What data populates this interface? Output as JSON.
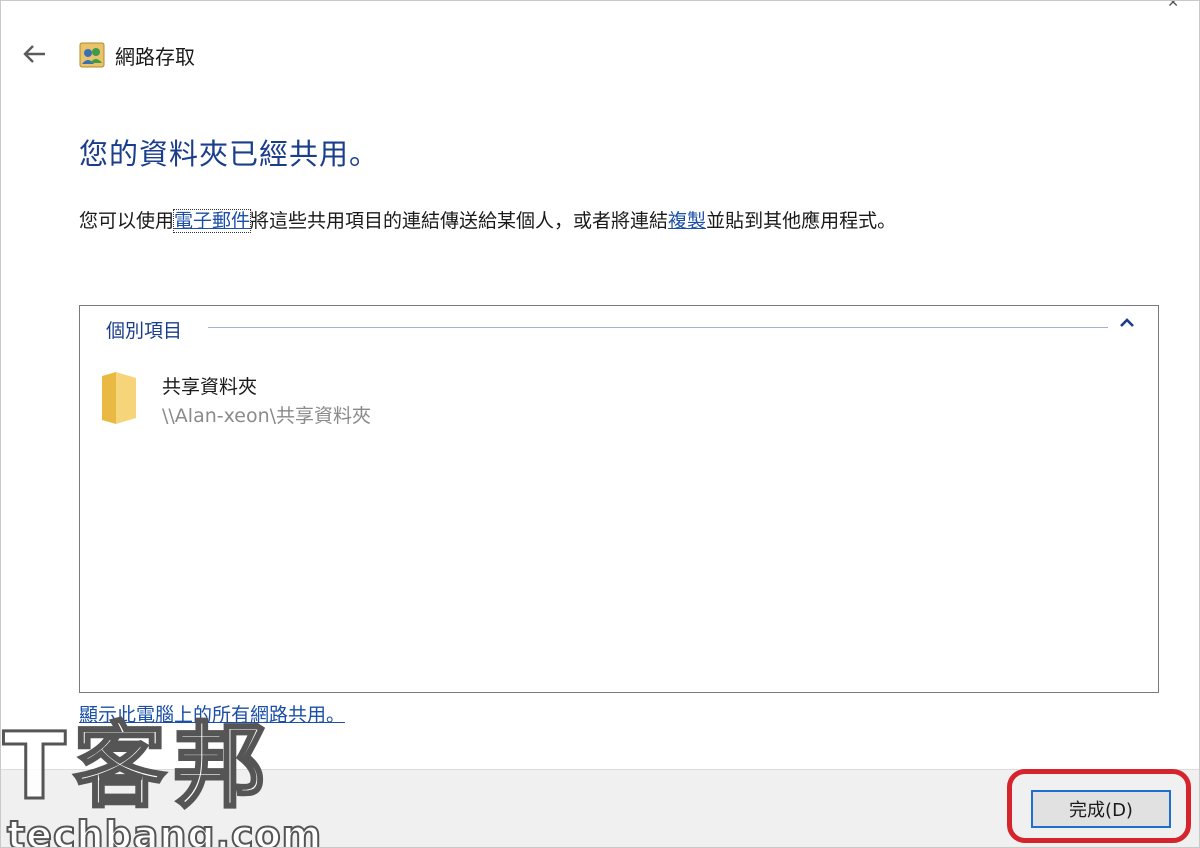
{
  "window": {
    "title": "網路存取",
    "close_glyph": "✕"
  },
  "icons": {
    "back": "back-arrow-icon",
    "app": "network-users-icon",
    "collapse": "chevron-up-icon",
    "folder": "folder-icon"
  },
  "heading": "您的資料夾已經共用。",
  "description": {
    "part1": "您可以使用",
    "email_link": "電子郵件",
    "part2": "將這些共用項目的連結傳送給某個人，或者將連結",
    "copy_link": "複製",
    "part3": "並貼到其他應用程式。"
  },
  "group": {
    "header": "個別項目",
    "items": [
      {
        "name": "共享資料夾",
        "path": "\\\\Alan-xeon\\共享資料夾"
      }
    ]
  },
  "show_all_link": "顯示此電腦上的所有網路共用。",
  "footer": {
    "done_label": "完成(D)"
  },
  "watermark": {
    "big": "T客邦",
    "small": "techbang.com"
  },
  "colors": {
    "heading": "#1b3e8c",
    "link": "#1b4fa8",
    "highlight": "#d6242c",
    "button_focus": "#1e6fd0"
  }
}
